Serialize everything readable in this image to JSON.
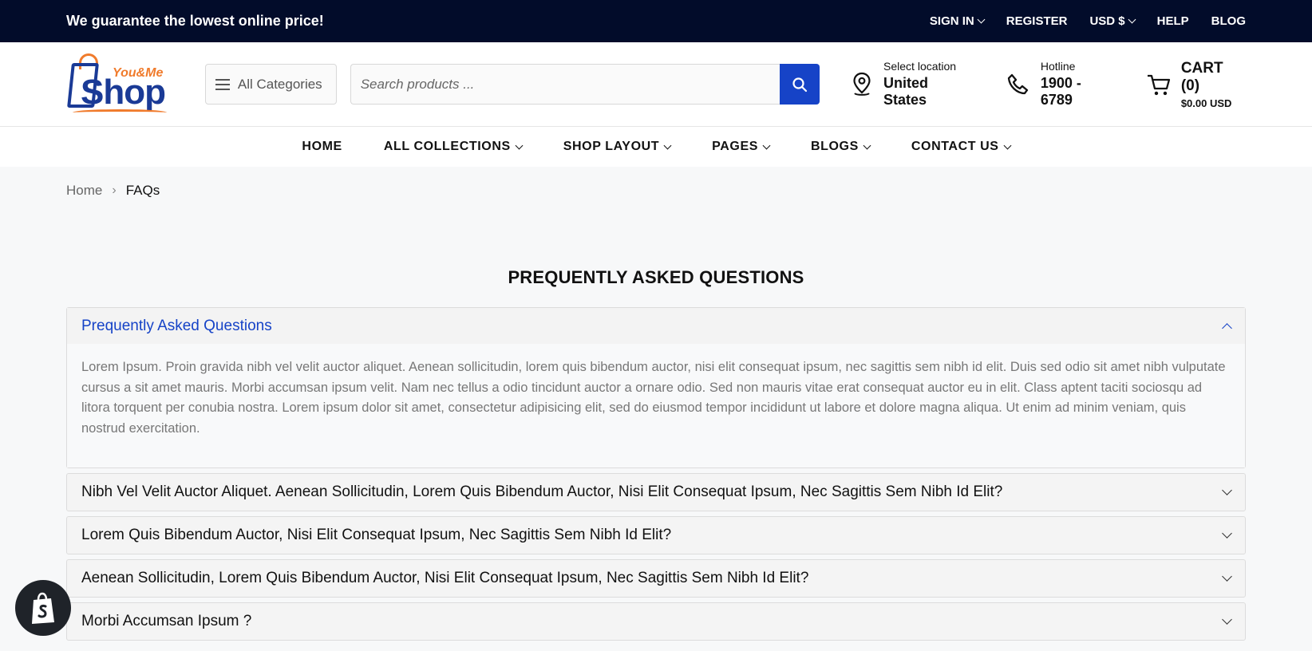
{
  "topbar": {
    "promo": "We guarantee the lowest online price!",
    "links": [
      {
        "label": "SIGN IN",
        "dropdown": true
      },
      {
        "label": "REGISTER",
        "dropdown": false
      },
      {
        "label": "USD $",
        "dropdown": true
      },
      {
        "label": "HELP",
        "dropdown": false
      },
      {
        "label": "BLOG",
        "dropdown": false
      }
    ]
  },
  "header": {
    "logo": {
      "line1": "You&Me",
      "line2": "Shop"
    },
    "categories_label": "All Categories",
    "search_placeholder": "Search products ...",
    "location": {
      "label": "Select location",
      "value": "United States"
    },
    "hotline": {
      "label": "Hotline",
      "value": "1900 - 6789"
    },
    "cart": {
      "label": "CART (0)",
      "total": "$0.00 USD"
    }
  },
  "nav": [
    {
      "label": "HOME",
      "dropdown": false
    },
    {
      "label": "ALL COLLECTIONS",
      "dropdown": true
    },
    {
      "label": "SHOP LAYOUT",
      "dropdown": true
    },
    {
      "label": "PAGES",
      "dropdown": true
    },
    {
      "label": "BLOGS",
      "dropdown": true
    },
    {
      "label": "CONTACT US",
      "dropdown": true
    }
  ],
  "breadcrumb": {
    "home": "Home",
    "current": "FAQs"
  },
  "page_title": "PREQUENTLY ASKED QUESTIONS",
  "faqs": [
    {
      "question": "Prequently Asked Questions",
      "open": true,
      "answer": "Lorem Ipsum. Proin gravida nibh vel velit auctor aliquet. Aenean sollicitudin, lorem quis bibendum auctor, nisi elit consequat ipsum, nec sagittis sem nibh id elit. Duis sed odio sit amet nibh vulputate cursus a sit amet mauris. Morbi accumsan ipsum velit. Nam nec tellus a odio tincidunt auctor a ornare odio. Sed non mauris vitae erat consequat auctor eu in elit. Class aptent taciti sociosqu ad litora torquent per conubia nostra. Lorem ipsum dolor sit amet, consectetur adipisicing elit, sed do eiusmod tempor incididunt ut labore et dolore magna aliqua. Ut enim ad minim veniam, quis nostrud exercitation."
    },
    {
      "question": "Nibh Vel Velit Auctor Aliquet. Aenean Sollicitudin, Lorem Quis Bibendum Auctor, Nisi Elit Consequat Ipsum, Nec Sagittis Sem Nibh Id Elit?",
      "open": false
    },
    {
      "question": "Lorem Quis Bibendum Auctor, Nisi Elit Consequat Ipsum, Nec Sagittis Sem Nibh Id Elit?",
      "open": false
    },
    {
      "question": "Aenean Sollicitudin, Lorem Quis Bibendum Auctor, Nisi Elit Consequat Ipsum, Nec Sagittis Sem Nibh Id Elit?",
      "open": false
    },
    {
      "question": "Morbi Accumsan Ipsum ?",
      "open": false
    }
  ],
  "colors": {
    "topbar_bg": "#020c2a",
    "accent": "#1643c7",
    "logo_orange": "#f07b2c",
    "logo_blue": "#1a3a96"
  },
  "icons": {
    "search": "search-icon",
    "location": "location-pin-icon",
    "phone": "phone-icon",
    "cart": "cart-icon",
    "shopify": "shopify-bag-icon"
  }
}
